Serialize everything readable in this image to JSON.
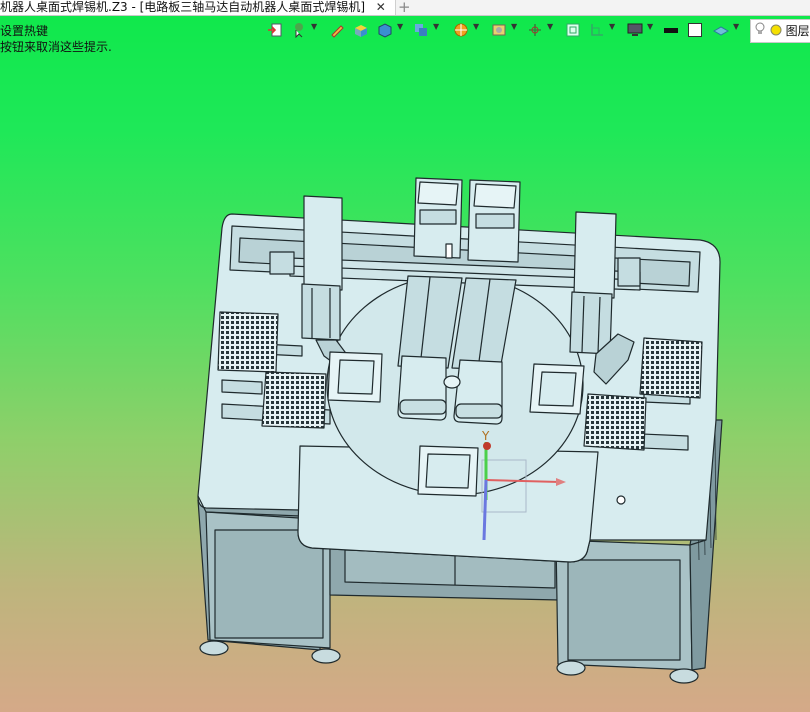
{
  "tabs": {
    "active_title": "机器人桌面式焊锡机.Z3 - [电路板三轴马达自动机器人桌面式焊锡机]",
    "close_glyph": "✕",
    "add_glyph": "+"
  },
  "hints": {
    "line1": "设置热键",
    "line2": "按钮来取消这些提示."
  },
  "toolbar": {
    "icons": [
      "exit-icon",
      "pointer-tool-icon",
      "pencil-icon",
      "shaded-box-icon",
      "cube-icon",
      "cube-stack-icon",
      "render-sphere-icon",
      "texture-icon",
      "axis-icon",
      "frame-icon",
      "orthogonal-frame-icon",
      "monitor-icon",
      "black-color-swatch-icon",
      "white-color-swatch-icon",
      "plane-icon"
    ]
  },
  "layers": {
    "label": "图层"
  },
  "viewport": {
    "axis_label_y": "Y",
    "background_top": "#0ee84a",
    "background_bottom": "#d5a988",
    "model_color": "#d7ecef",
    "model_edge": "#1f2a2d"
  }
}
